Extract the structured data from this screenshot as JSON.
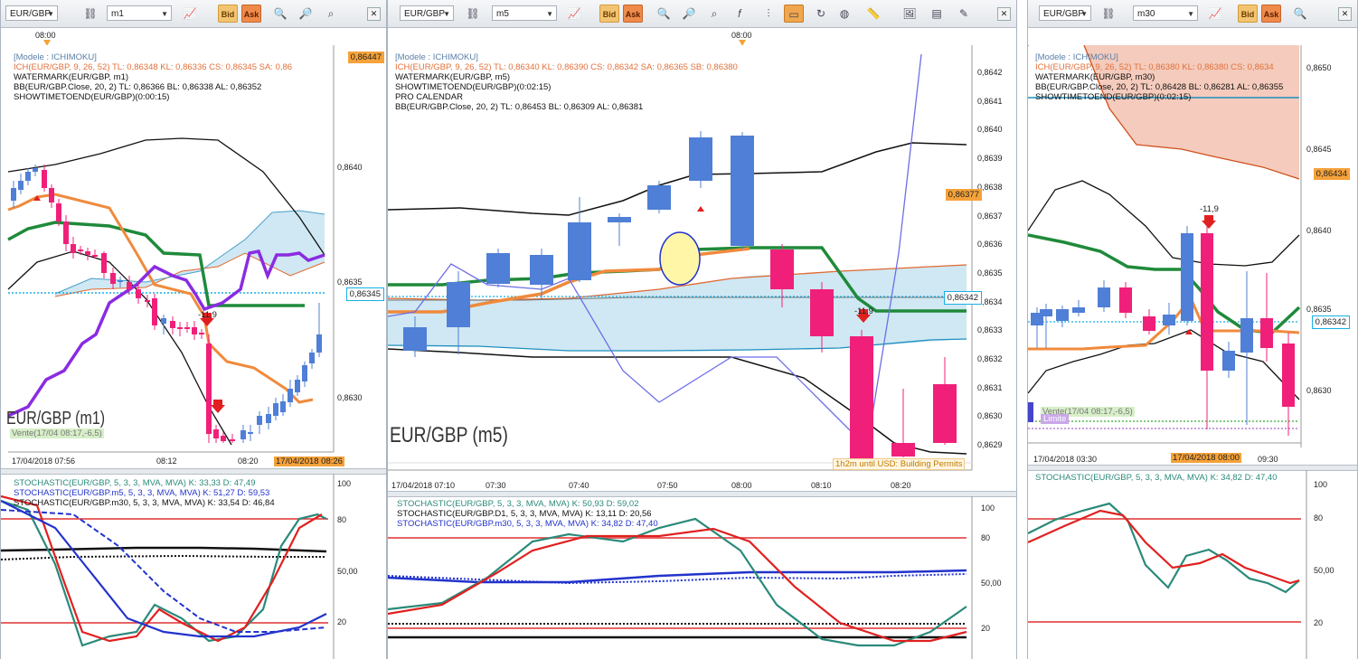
{
  "panels": {
    "p1": {
      "symbol": "EUR/GBP",
      "timeframe": "m1",
      "bid": "Bid",
      "ask": "Ask",
      "time_marker": "08:00",
      "indicators": [
        {
          "text": "[Modele : ICHIMOKU]",
          "color": "#5a7fa8"
        },
        {
          "text": "ICH(EUR/GBP, 9, 26, 52)  TL: 0,86348   KL: 0,86336   CS: 0,86345   SA: 0,86",
          "color": "#e0703a"
        },
        {
          "text": "WATERMARK(EUR/GBP, m1)",
          "color": "#111"
        },
        {
          "text": "BB(EUR/GBP.Close, 20, 2)  TL: 0,86366  BL: 0,86338   AL: 0,86352",
          "color": "#111"
        },
        {
          "text": "SHOWTIMETOEND(EUR/GBP)(0:00:15)",
          "color": "#111"
        }
      ],
      "price_labels": [
        "0,8640",
        "0,8635",
        "0,8630"
      ],
      "price_tags": {
        "top": "0,86447",
        "current": "0,86345"
      },
      "watermark": "EUR/GBP (m1)",
      "order_label": "Vente(17/04 08:17,-6,5)",
      "signal": "-11,9",
      "time_labels": [
        "17/04/2018 07:56",
        "08:12",
        "08:20"
      ],
      "time_tag": "17/04/2018 08:26",
      "stoch_lines": [
        {
          "text": "STOCHASTIC(EUR/GBP, 5, 3, 3, MVA, MVA)  K: 33,33   D: 47,49",
          "color": "#2a8a7a"
        },
        {
          "text": "STOCHASTIC(EUR/GBP.m5, 5, 3, 3, MVA, MVA)  K: 51,27  D: 59,53",
          "color": "#2233cc"
        },
        {
          "text": "STOCHASTIC(EUR/GBP.m30, 5, 3, 3, MVA, MVA)  K: 33,54  D: 46,84",
          "color": "#111"
        }
      ],
      "stoch_levels": [
        "100",
        "80",
        "50,00",
        "20"
      ]
    },
    "p2": {
      "symbol": "EUR/GBP",
      "timeframe": "m5",
      "bid": "Bid",
      "ask": "Ask",
      "time_marker": "08:00",
      "indicators": [
        {
          "text": "[Modele : ICHIMOKU]",
          "color": "#5a7fa8"
        },
        {
          "text": "ICH(EUR/GBP, 9, 26, 52)  TL: 0,86340   KL: 0,86390   CS: 0,86342   SA: 0,86365   SB: 0,86380",
          "color": "#e0703a"
        },
        {
          "text": "WATERMARK(EUR/GBP, m5)",
          "color": "#111"
        },
        {
          "text": "SHOWTIMETOEND(EUR/GBP)(0:02:15)",
          "color": "#111"
        },
        {
          "text": "PRO CALENDAR",
          "color": "#111"
        },
        {
          "text": "BB(EUR/GBP.Close, 20, 2)  TL: 0,86453   BL: 0,86309   AL: 0,86381",
          "color": "#111"
        }
      ],
      "price_labels": [
        "0,8642",
        "0,8641",
        "0,8640",
        "0,8639",
        "0,8638",
        "0,8637",
        "0,8636",
        "0,8635",
        "0,8634",
        "0,8633",
        "0,8632",
        "0,8631",
        "0,8630",
        "0,8629"
      ],
      "price_tags": {
        "a": "0,86377",
        "b": "0,86342"
      },
      "watermark": "EUR/GBP (m5)",
      "calendar_note": "1h2m until USD: Building Permits",
      "signal": "-11,9",
      "time_labels": [
        "17/04/2018 07:10",
        "07:30",
        "07:40",
        "07:50",
        "08:00",
        "08:10",
        "08:20"
      ],
      "stoch_lines": [
        {
          "text": "STOCHASTIC(EUR/GBP, 5, 3, 3, MVA, MVA)  K: 50,93  D: 59,02",
          "color": "#2a8a7a"
        },
        {
          "text": "STOCHASTIC(EUR/GBP.D1, 5, 3, 3, MVA, MVA)  K: 13,11  D: 20,56",
          "color": "#111"
        },
        {
          "text": "STOCHASTIC(EUR/GBP.m30, 5, 3, 3, MVA, MVA)  K: 34,82  D: 47,40",
          "color": "#2233cc"
        }
      ],
      "stoch_levels": [
        "100",
        "80",
        "50,00",
        "20"
      ]
    },
    "p3": {
      "symbol": "EUR/GBP",
      "timeframe": "m30",
      "bid": "Bid",
      "ask": "Ask",
      "indicators": [
        {
          "text": "[Modele : ICHIMOKU]",
          "color": "#5a7fa8"
        },
        {
          "text": "ICH(EUR/GBP, 9, 26, 52)  TL: 0,86380   KL: 0,86380   CS: 0,8634",
          "color": "#e0703a"
        },
        {
          "text": "WATERMARK(EUR/GBP, m30)",
          "color": "#111"
        },
        {
          "text": "BB(EUR/GBP.Close, 20, 2)  TL: 0,86428  BL: 0,86281   AL: 0,86355",
          "color": "#111"
        },
        {
          "text": "SHOWTIMETOEND(EUR/GBP)(0:02:15)",
          "color": "#111"
        }
      ],
      "price_labels": [
        "0,8650",
        "0,8645",
        "0,8640",
        "0,8635",
        "0,8630"
      ],
      "price_tags": {
        "a": "0,86434",
        "b": "0,86342"
      },
      "order_label": "Vente(17/04 08:17,-6,5)",
      "limit_label": "Limite",
      "signal": "-11,9",
      "time_labels": [
        "17/04/2018 03:30",
        "09:30"
      ],
      "time_tag": "17/04/2018 08:00",
      "stoch_lines": [
        {
          "text": "STOCHASTIC(EUR/GBP, 5, 3, 3, MVA, MVA)  K: 34,82  D: 47,40",
          "color": "#2a8a7a"
        }
      ],
      "stoch_levels": [
        "100",
        "80",
        "50,00",
        "20"
      ]
    }
  },
  "colors": {
    "bull": "#4f7fd6",
    "bear": "#f0207a",
    "kijun": "#1f8a3a",
    "tenkan": "#f08a3c",
    "chikou": "#8a2be2",
    "cloud": "#bfe0ef",
    "overbought": "#e03030",
    "current_price": "#19b0e6",
    "price_tag": "#f5a23a"
  }
}
